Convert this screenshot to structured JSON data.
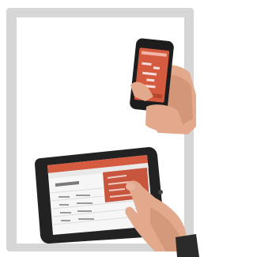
{
  "scene": {
    "frame_color": "#d6d6d6",
    "background_color": "#ffffff",
    "accent_color": "#d45a40",
    "phone_label": "",
    "tablet_app_title": "",
    "tablet_header": ""
  }
}
